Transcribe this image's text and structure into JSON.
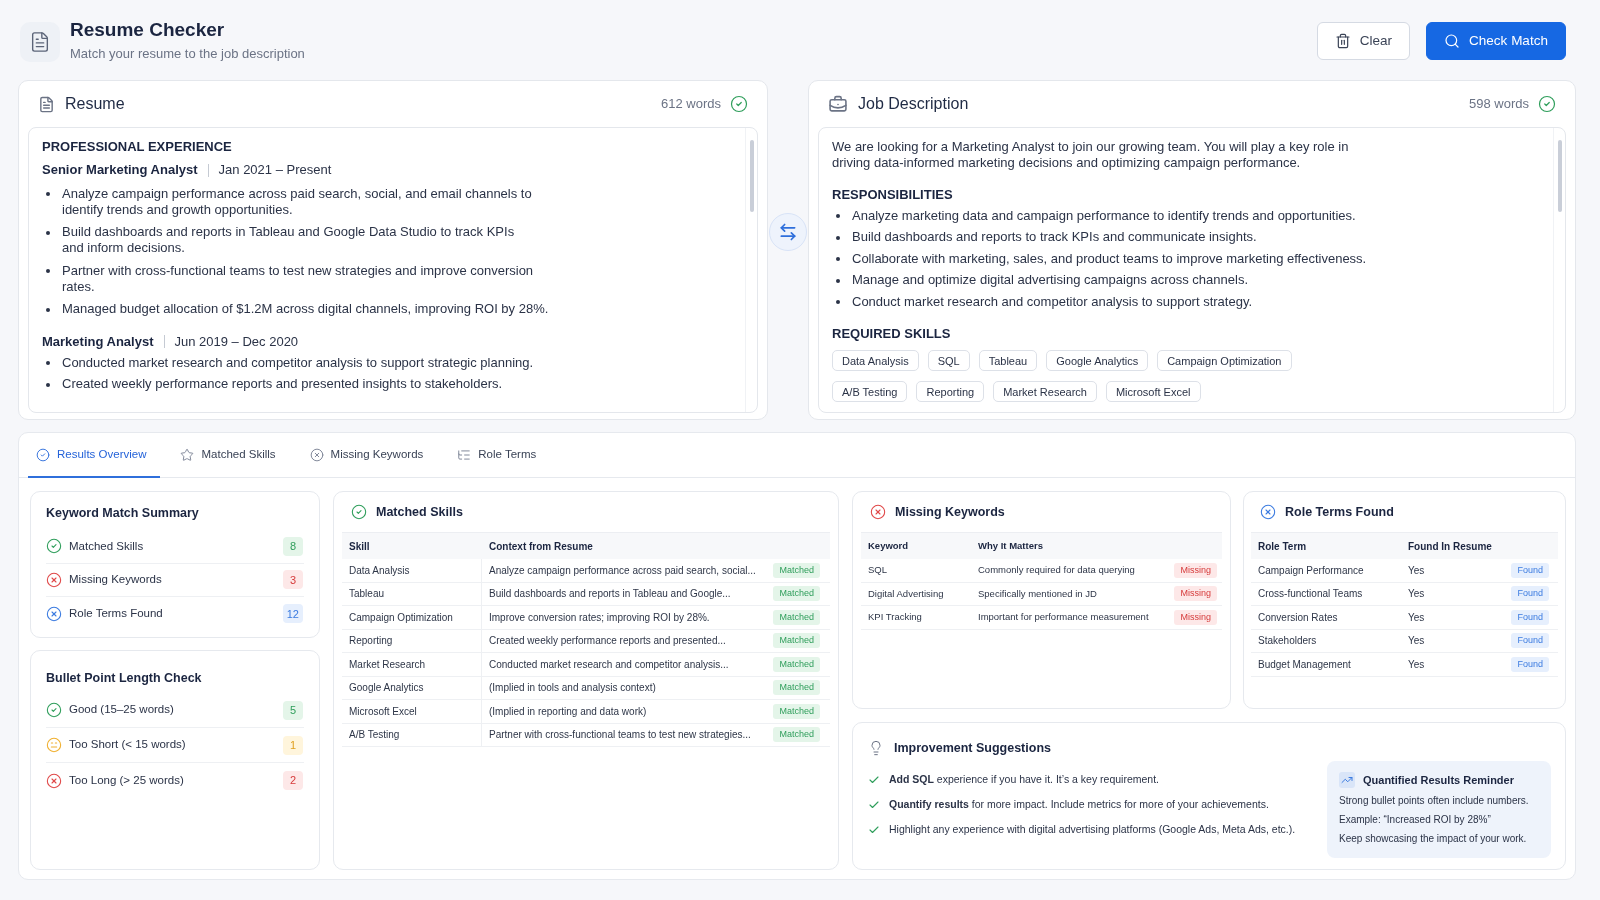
{
  "header": {
    "title": "Resume Checker",
    "subtitle": "Match your resume to the job description",
    "buttons": [
      {
        "label": "Clear",
        "kind": "secondary"
      },
      {
        "label": "Check Match",
        "kind": "primary"
      }
    ]
  },
  "resume": {
    "title": "Resume",
    "word_count": "612 words",
    "heading": "PROFESSIONAL EXPERIENCE",
    "jobs": [
      {
        "role": "Senior Marketing Analyst",
        "dates": "Jan 2021 – Present",
        "bullets": [
          {
            "lines": [
              "Analyze campaign performance across paid search, social, and email channels to",
              "identify trends and growth opportunities."
            ]
          },
          {
            "lines": [
              "Build dashboards and reports in Tableau and Google Data Studio to track KPIs",
              "and inform decisions."
            ]
          },
          {
            "lines": [
              "Partner with cross-functional teams to test new strategies and improve conversion",
              "rates."
            ]
          },
          {
            "lines": [
              "Managed budget allocation of $1.2M across digital channels, improving ROI by 28%."
            ]
          }
        ]
      },
      {
        "role": "Marketing Analyst",
        "dates": "Jun 2019 – Dec 2020",
        "bullets": [
          {
            "lines": [
              "Conducted market research and competitor analysis to support strategic planning."
            ]
          },
          {
            "lines": [
              "Created weekly performance reports and presented insights to stakeholders."
            ]
          }
        ]
      }
    ]
  },
  "job_description": {
    "title": "Job Description",
    "word_count": "598 words",
    "intro": [
      "We are looking for a Marketing Analyst to join our growing team. You will play a key role in",
      "driving data-informed marketing decisions and optimizing campaign performance."
    ],
    "responsibilities": {
      "heading": "RESPONSIBILITIES",
      "bullets": [
        "Analyze marketing data and campaign performance to identify trends and opportunities.",
        "Build dashboards and reports to track KPIs and communicate insights.",
        "Collaborate with marketing, sales, and product teams to improve marketing effectiveness.",
        "Manage and optimize digital advertising campaigns across channels.",
        "Conduct market research and competitor analysis to support strategy."
      ]
    },
    "required_skills": {
      "heading": "REQUIRED SKILLS",
      "tags": [
        "Data Analysis",
        "SQL",
        "Tableau",
        "Google Analytics",
        "Campaign Optimization",
        "A/B Testing",
        "Reporting",
        "Market Research",
        "Microsoft Excel"
      ]
    }
  },
  "results": {
    "tabs": [
      {
        "label": "Results Overview",
        "selected": true
      },
      {
        "label": "Matched Skills",
        "selected": false
      },
      {
        "label": "Missing Keywords",
        "selected": false
      },
      {
        "label": "Role Terms",
        "selected": false
      }
    ],
    "keyword_summary": {
      "title": "Keyword Match Summary",
      "items": [
        {
          "label": "Matched Skills",
          "count": "8",
          "kind": "matched"
        },
        {
          "label": "Missing Keywords",
          "count": "3",
          "kind": "missing"
        },
        {
          "label": "Role Terms Found",
          "count": "12",
          "kind": "found"
        }
      ]
    },
    "bullet_check": {
      "title": "Bullet Point Length Check",
      "items": [
        {
          "label": "Good (15–25 words)",
          "count": "5",
          "kind": "good"
        },
        {
          "label": "Too Short (< 15 words)",
          "count": "1",
          "kind": "short"
        },
        {
          "label": "Too Long (> 25 words)",
          "count": "2",
          "kind": "long"
        }
      ]
    },
    "matched_skills": {
      "title": "Matched Skills",
      "columns": [
        "Skill",
        "Context from Resume"
      ],
      "rows": [
        {
          "skill": "Data Analysis",
          "context": "Analyze campaign performance across paid search, social...",
          "status": "Matched"
        },
        {
          "skill": "Tableau",
          "context": "Build dashboards and reports in Tableau and Google...",
          "status": "Matched"
        },
        {
          "skill": "Campaign Optimization",
          "context": "Improve conversion rates; improving ROI by 28%.",
          "status": "Matched"
        },
        {
          "skill": "Reporting",
          "context": "Created weekly performance reports and presented...",
          "status": "Matched"
        },
        {
          "skill": "Market Research",
          "context": "Conducted market research and competitor analysis...",
          "status": "Matched"
        },
        {
          "skill": "Google Analytics",
          "context": "(Implied in tools and analysis context)",
          "status": "Matched"
        },
        {
          "skill": "Microsoft Excel",
          "context": "(Implied in reporting and data work)",
          "status": "Matched"
        },
        {
          "skill": "A/B Testing",
          "context": "Partner with cross-functional teams to test new strategies...",
          "status": "Matched"
        }
      ]
    },
    "missing_keywords": {
      "title": "Missing Keywords",
      "columns": [
        "Keyword",
        "Why It Matters"
      ],
      "rows": [
        {
          "keyword": "SQL",
          "reason": "Commonly required for data querying",
          "status": "Missing"
        },
        {
          "keyword": "Digital Advertising",
          "reason": "Specifically mentioned in JD",
          "status": "Missing"
        },
        {
          "keyword": "KPI Tracking",
          "reason": "Important for performance measurement",
          "status": "Missing"
        }
      ]
    },
    "role_terms": {
      "title": "Role Terms Found",
      "columns": [
        "Role Term",
        "Found In Resume"
      ],
      "rows": [
        {
          "term": "Campaign Performance",
          "found": "Yes",
          "status": "Found"
        },
        {
          "term": "Cross-functional Teams",
          "found": "Yes",
          "status": "Found"
        },
        {
          "term": "Conversion Rates",
          "found": "Yes",
          "status": "Found"
        },
        {
          "term": "Stakeholders",
          "found": "Yes",
          "status": "Found"
        },
        {
          "term": "Budget Management",
          "found": "Yes",
          "status": "Found"
        }
      ]
    },
    "suggestions": {
      "title": "Improvement Suggestions",
      "items": [
        "**Add SQL** experience if you have it. It’s a key requirement.",
        "**Quantify results** for more impact. Include metrics for more of your achievements.",
        "Highlight any experience with digital advertising platforms (Google Ads, Meta Ads, etc.)."
      ],
      "reminder": {
        "title": "Quantified Results Reminder",
        "lines": [
          "Strong bullet points often include numbers.",
          "Example: “Increased ROI by 28%”",
          "Keep showcasing the impact of your work."
        ]
      }
    }
  }
}
